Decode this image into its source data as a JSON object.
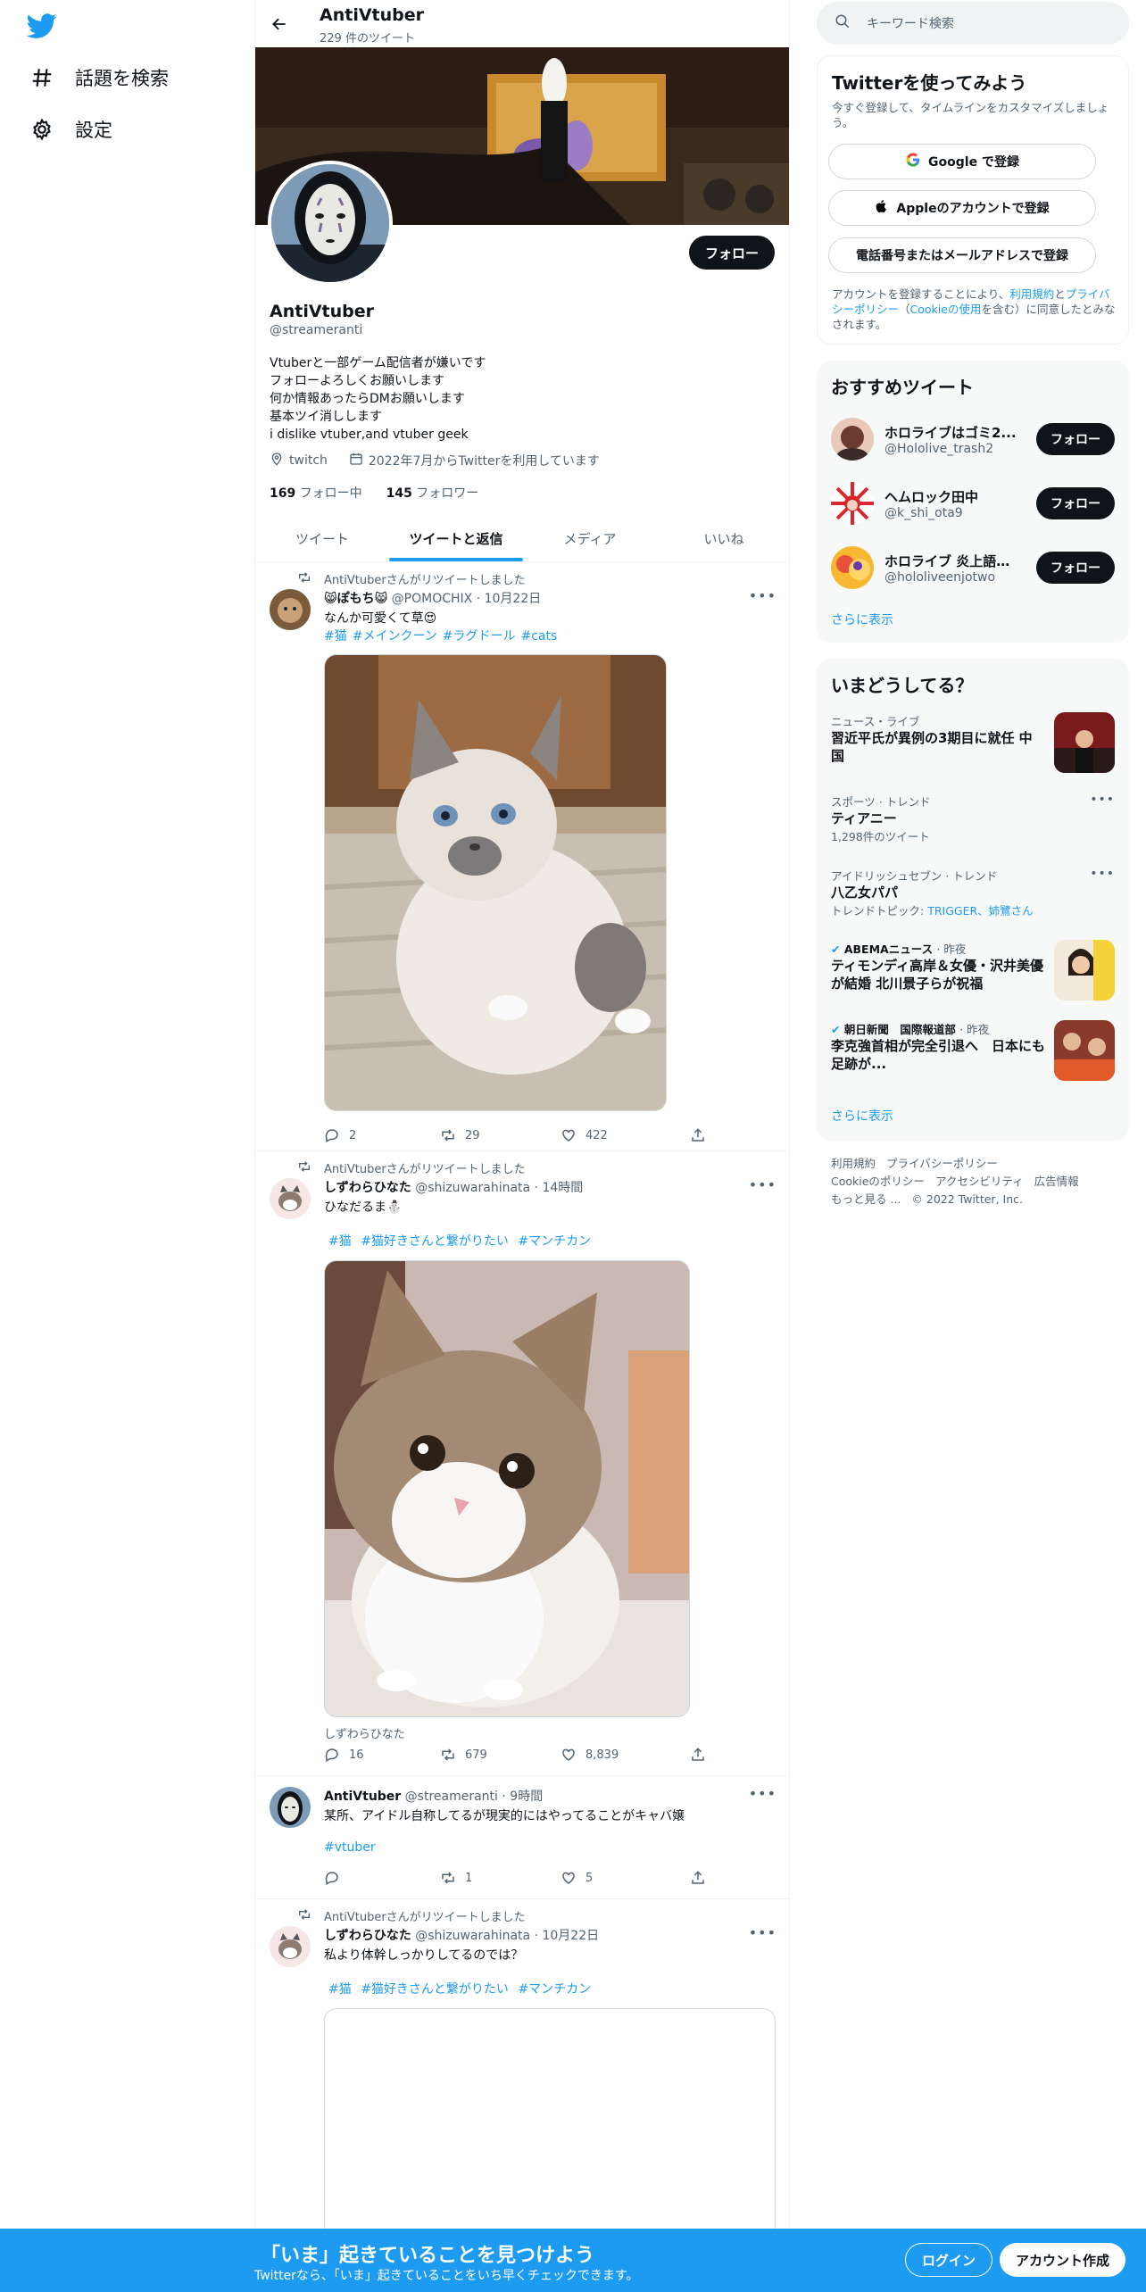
{
  "nav": {
    "explore": "話題を検索",
    "settings": "設定"
  },
  "header": {
    "name": "AntiVtuber",
    "tweet_count": "229 件のツイート"
  },
  "profile": {
    "name": "AntiVtuber",
    "handle": "@streameranti",
    "follow": "フォロー",
    "bio": [
      "Vtuberと一部ゲーム配信者が嫌いです",
      "フォローよろしくお願いします",
      "何か情報あったらDMお願いします",
      "基本ツイ消しします",
      "i dislike vtuber,and vtuber geek"
    ],
    "location": "twitch",
    "joined": "2022年7月からTwitterを利用しています",
    "following_count": "169",
    "following_label": "フォロー中",
    "followers_count": "145",
    "followers_label": "フォロワー"
  },
  "tabs": [
    "ツイート",
    "ツイートと返信",
    "メディア",
    "いいね"
  ],
  "tweets": [
    {
      "retweet": "AntiVtuberさんがリツイートしました",
      "name": "😸ぽもち😸",
      "handle": "@POMOCHIX",
      "time": "· 10月22日",
      "text": "なんか可愛くて草😍",
      "tags": [
        "#猫",
        "#メインクーン",
        "#ラグドール",
        "#cats"
      ],
      "replies": "2",
      "retweets": "29",
      "likes": "422"
    },
    {
      "retweet": "AntiVtuberさんがリツイートしました",
      "name": "しずわらひなた",
      "handle": "@shizuwarahinata",
      "time": "· 14時間",
      "text": "ひなだるま⛄",
      "tags": [
        "#猫",
        "#猫好きさんと繋がりたい",
        "#マンチカン"
      ],
      "caption": "しずわらひなた",
      "replies": "16",
      "retweets": "679",
      "likes": "8,839"
    },
    {
      "name": "AntiVtuber",
      "handle": "@streameranti",
      "time": "· 9時間",
      "text": "某所、アイドル自称してるが現実的にはやってることがキャバ嬢",
      "tags": [
        "#vtuber"
      ],
      "replies": "",
      "retweets": "1",
      "likes": "5"
    },
    {
      "retweet": "AntiVtuberさんがリツイートしました",
      "name": "しずわらひなた",
      "handle": "@shizuwarahinata",
      "time": "· 10月22日",
      "text": "私より体幹しっかりしてるのでは？",
      "tags": [
        "#猫",
        "#猫好きさんと繋がりたい",
        "#マンチカン"
      ]
    }
  ],
  "search": {
    "placeholder": "キーワード検索"
  },
  "signup": {
    "title": "Twitterを使ってみよう",
    "subtitle": "今すぐ登録して、タイムラインをカスタマイズしましょう。",
    "google": "Google で登録",
    "apple": "Appleのアカウントで登録",
    "phone": "電話番号またはメールアドレスで登録",
    "terms_pre": "アカウントを登録することにより、",
    "terms_link": "利用規約",
    "terms_mid": "と",
    "privacy_link": "プライバシーポリシー",
    "cookie_pre": "（",
    "cookie_link": "Cookieの使用",
    "terms_post": "を含む）に同意したとみなされます。"
  },
  "recommended": {
    "title": "おすすめツイート",
    "items": [
      {
        "name": "ホロライブはゴミ2...",
        "handle": "@Hololive_trash2",
        "button": "フォロー"
      },
      {
        "name": "ヘムロック田中",
        "handle": "@k_shi_ota9",
        "button": "フォロー"
      },
      {
        "name": "ホロライブ 炎上語録...",
        "handle": "@hololiveenjotwo",
        "button": "フォロー"
      }
    ],
    "more": "さらに表示"
  },
  "trends": {
    "title": "いまどうしてる？",
    "items": [
      {
        "category": "ニュース・ライブ",
        "title": "習近平氏が異例の3期目に就任 中国"
      },
      {
        "category": "スポーツ · トレンド",
        "title": "ティアニー",
        "sub": "1,298件のツイート"
      },
      {
        "category": "アイドリッシュセブン · トレンド",
        "title": "八乙女パパ",
        "sub_pre": "トレンドトピック: ",
        "sub_link": "TRIGGER、姉鷺さん"
      },
      {
        "category": "ABEMAニュース",
        "time": "· 昨夜",
        "title": "ティモンディ高岸＆女優・沢井美優が結婚 北川景子らが祝福"
      },
      {
        "category": "朝日新聞　国際報道部",
        "time": "· 昨夜",
        "title": "李克強首相が完全引退へ　日本にも足跡が..."
      }
    ],
    "more": "さらに表示"
  },
  "footer": {
    "terms": "利用規約",
    "privacy": "プライバシーポリシー",
    "cookie": "Cookieのポリシー",
    "access": "アクセシビリティ",
    "ads": "広告情報",
    "more": "もっと見る ...",
    "copyright": "© 2022 Twitter, Inc."
  },
  "bottom": {
    "title": "「いま」起きていることを見つけよう",
    "subtitle": "Twitterなら、「いま」起きていることをいち早くチェックできます。",
    "login": "ログイン",
    "signup": "アカウント作成"
  },
  "colors": {
    "accent": "#1d9bf0",
    "text": "#0f1419",
    "muted": "#536471"
  }
}
